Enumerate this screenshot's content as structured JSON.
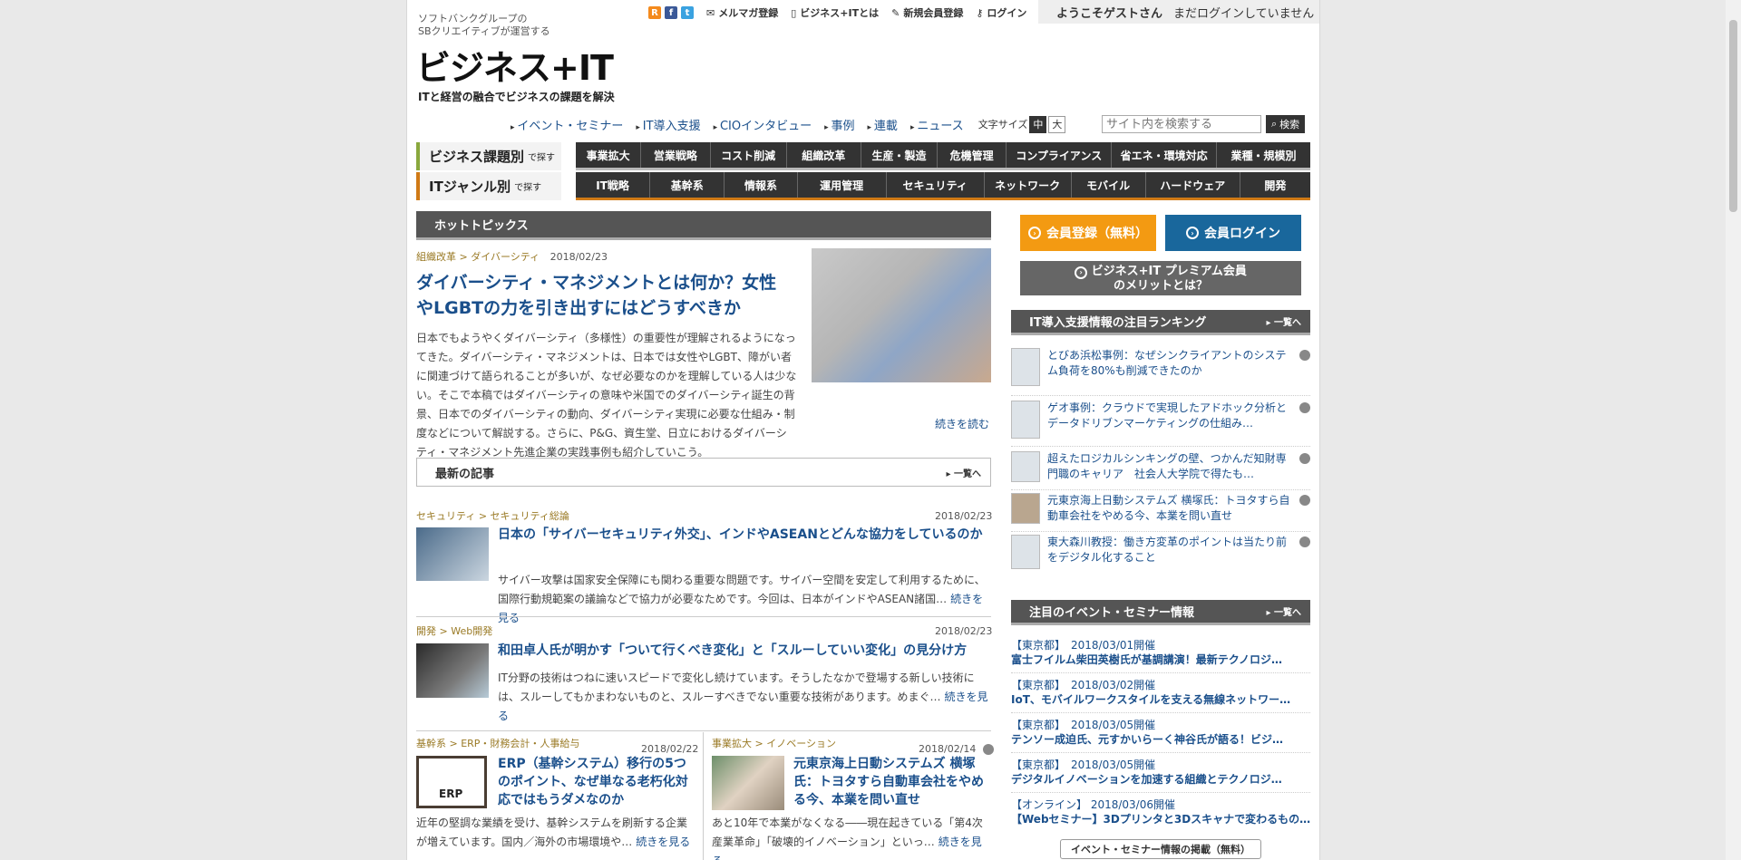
{
  "header": {
    "tagline_1": "ソフトバンクグループの",
    "tagline_2": "SBクリエイティブが運営する",
    "logo": "ビジネス+IT",
    "logo_sub": "ITと経営の融合でビジネスの課題を解決"
  },
  "toplinks": {
    "rss": "R",
    "facebook": "f",
    "twitter": "t",
    "mail": "メルマガ登録",
    "about": "ビジネス+ITとは",
    "register": "新規会員登録",
    "login": "ログイン",
    "welcome": "ようこそゲストさん",
    "status": "まだログインしていません"
  },
  "nav": {
    "items": [
      "イベント・セミナー",
      "IT導入支援",
      "CIOインタビュー",
      "事例",
      "連載",
      "ニュース"
    ],
    "font_size_label": "文字サイズ",
    "font_mid": "中",
    "font_large": "大",
    "search_placeholder": "サイト内を検索する",
    "search_button": "検索"
  },
  "categories": {
    "business_label": "ビジネス課題別",
    "business_sub": "で探す",
    "business_items": [
      "事業拡大",
      "営業戦略",
      "コスト削減",
      "組織改革",
      "生産・製造",
      "危機管理",
      "コンプライアンス",
      "省エネ・環境対応",
      "業種・規模別"
    ],
    "it_label": "ITジャンル別",
    "it_sub": "で探す",
    "it_items": [
      "IT戦略",
      "基幹系",
      "情報系",
      "運用管理",
      "セキュリティ",
      "ネットワーク",
      "モバイル",
      "ハードウェア",
      "開発"
    ]
  },
  "hot": {
    "section": "ホットトピックス",
    "crumb": "組織改革 > ダイバーシティ",
    "date": "2018/02/23",
    "title": "ダイバーシティ・マネジメントとは何か？女性やLGBTの力を引き出すにはどうすべきか",
    "body": "日本でもようやくダイバーシティ（多様性）の重要性が理解されるようになってきた。ダイバーシティ・マネジメントは、日本では女性やLGBT、障がい者に関連づけて語られることが多いが、なぜ必要なのかを理解している人は少ない。そこで本稿ではダイバーシティの意味や米国でのダイバーシティ誕生の背景、日本でのダイバーシティの動向、ダイバーシティ実現に必要な仕組み・制度などについて解説する。さらに、P&G、資生堂、日立におけるダイバーシティ・マネジメント先進企業の実践事例も紹介していこう。",
    "readmore": "続きを読む"
  },
  "latest": {
    "section": "最新の記事",
    "more": "一覧へ",
    "articles": [
      {
        "crumb": "セキュリティ > セキュリティ総論",
        "date": "2018/02/23",
        "title": "日本の「サイバーセキュリティ外交」、インドやASEANとどんな協力をしているのか",
        "body": "サイバー攻撃は国家安全保障にも関わる重要な問題です。サイバー空間を安定して利用するために、国際行動規範案の議論などで協力が必要なためです。今回は、日本がインドやASEAN諸国…",
        "readmore": "続きを見る"
      },
      {
        "crumb": "開発 > Web開発",
        "date": "2018/02/23",
        "title": "和田卓人氏が明かす「ついて行くべき変化」と「スルーしていい変化」の見分け方",
        "body": "IT分野の技術はつねに速いスピードで変化し続けています。そうしたなかで登場する新しい技術には、スルーしてもかまわないものと、スルーすべきでない重要な技術があります。めまぐ…",
        "readmore": "続きを見る"
      },
      {
        "crumb": "基幹系 > ERP・財務会計・人事給与",
        "date": "2018/02/22",
        "title": "ERP（基幹システム）移行の5つのポイント、なぜ単なる老朽化対応ではもうダメなのか",
        "body": "近年の堅調な業績を受け、基幹システムを刷新する企業が増えています。国内／海外の市場環境や…",
        "readmore": "続きを見る"
      },
      {
        "crumb": "事業拡大 > イノベーション",
        "date": "2018/02/14",
        "title": "元東京海上日動システムズ 横塚氏：トヨタすら自動車会社をやめる今、本業を問い直せ",
        "body": "あと10年で本業がなくなる――現在起きている「第4次産業革命」「破壊的イノベーション」といっ…",
        "readmore": "続きを見る"
      }
    ]
  },
  "sidebar": {
    "register_btn": "会員登録（無料）",
    "login_btn": "会員ログイン",
    "premium_1": "ビジネス+IT プレミアム会員",
    "premium_2": "のメリットとは？",
    "ranking_title": "IT導入支援情報の注目ランキング",
    "more": "一覧へ",
    "ranking": [
      "とびあ浜松事例：なぜシンクライアントのシステム負荷を80%も削減できたのか",
      "ゲオ事例：クラウドで実現したアドホック分析とデータドリブンマーケティングの仕組み…",
      "超えたロジカルシンキングの壁、つかんだ知財専門職のキャリア　社会人大学院で得たも…",
      "元東京海上日動システムズ 横塚氏：トヨタすら自動車会社をやめる今、本業を問い直せ",
      "東大森川教授：働き方変革のポイントは当たり前をデジタル化すること"
    ],
    "events_title": "注目のイベント・セミナー情報",
    "events": [
      {
        "loc": "【東京都】　2018/03/01開催",
        "title": "富士フイルム柴田英樹氏が基調講演！最新テクノロジ…"
      },
      {
        "loc": "【東京都】　2018/03/02開催",
        "title": "IoT、モバイルワークスタイルを支える無線ネットワー…"
      },
      {
        "loc": "【東京都】　2018/03/05開催",
        "title": "テンソー成迫氏、元すかいらーく神谷氏が語る！ビジ…"
      },
      {
        "loc": "【東京都】　2018/03/05開催",
        "title": "デジタルイノベーションを加速する組織とテクノロジ…"
      },
      {
        "loc": "【オンライン】 2018/03/06開催",
        "title": "【Webセミナー】3Dプリンタと3Dスキャナで変わるもの…"
      }
    ],
    "events_post": "イベント・セミナー情報の掲載（無料）"
  }
}
